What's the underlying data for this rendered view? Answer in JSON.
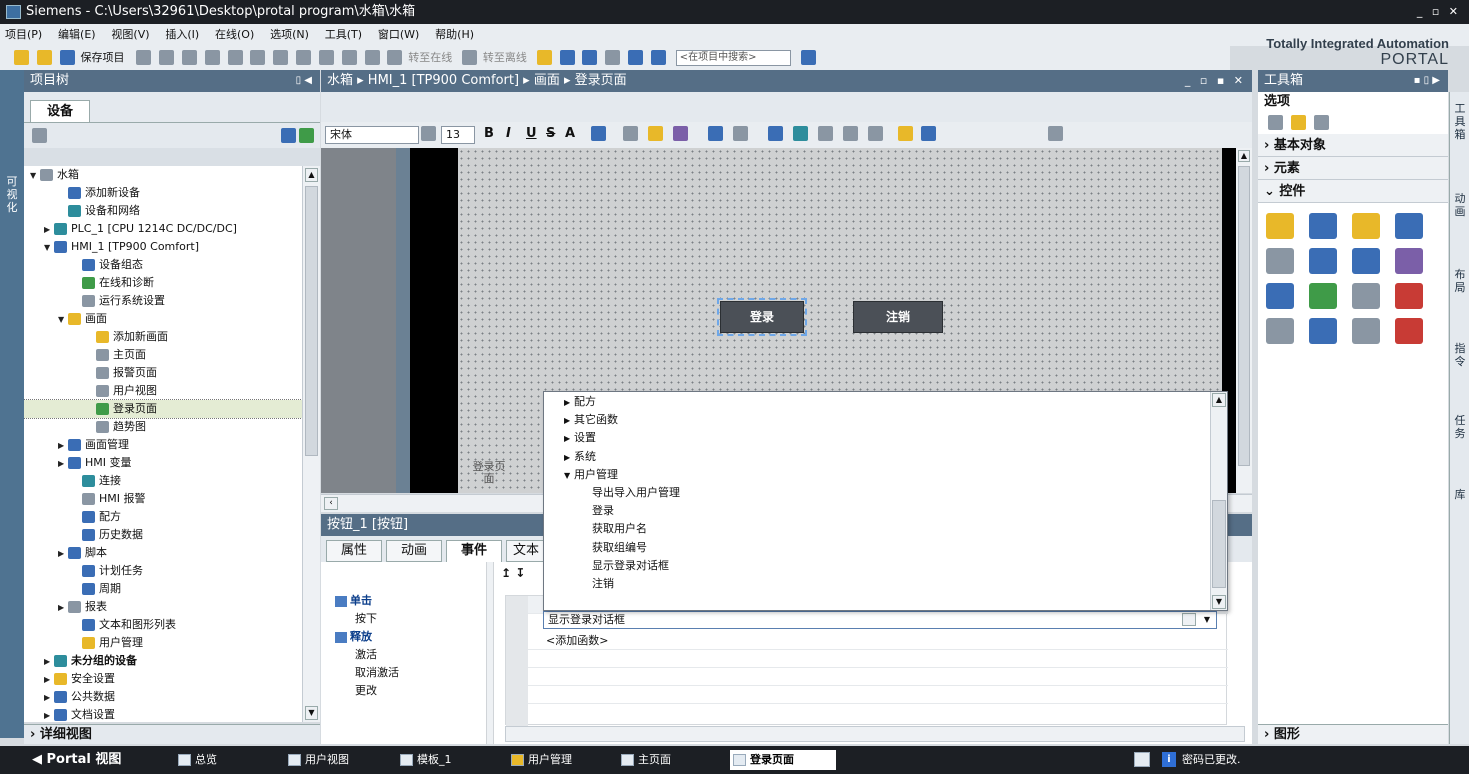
{
  "window": {
    "title": "Siemens  -  C:\\Users\\32961\\Desktop\\protal program\\水箱\\水箱",
    "controls": "_ ▫ ✕"
  },
  "menubar": [
    "项目(P)",
    "编辑(E)",
    "视图(V)",
    "插入(I)",
    "在线(O)",
    "选项(N)",
    "工具(T)",
    "窗口(W)",
    "帮助(H)"
  ],
  "toolbar": {
    "save_label": "保存项目",
    "go_online": "转至在线",
    "go_offline": "转至离线",
    "search_placeholder": "<在项目中搜索>"
  },
  "brand": {
    "line1": "Totally Integrated Automation",
    "line2": "PORTAL"
  },
  "left_vtab": "可视化",
  "project_tree": {
    "title": "项目树",
    "tab": "设备",
    "items": [
      {
        "label": "水箱",
        "indent": 0,
        "arrow": "▼",
        "icon": "ico-grey"
      },
      {
        "label": "添加新设备",
        "indent": 2,
        "arrow": "",
        "icon": "ico-blue"
      },
      {
        "label": "设备和网络",
        "indent": 2,
        "arrow": "",
        "icon": "ico-teal"
      },
      {
        "label": "PLC_1 [CPU 1214C DC/DC/DC]",
        "indent": 1,
        "arrow": "▶",
        "icon": "ico-teal"
      },
      {
        "label": "HMI_1 [TP900 Comfort]",
        "indent": 1,
        "arrow": "▼",
        "icon": "ico-blue"
      },
      {
        "label": "设备组态",
        "indent": 3,
        "arrow": "",
        "icon": "ico-blue"
      },
      {
        "label": "在线和诊断",
        "indent": 3,
        "arrow": "",
        "icon": "ico-green"
      },
      {
        "label": "运行系统设置",
        "indent": 3,
        "arrow": "",
        "icon": "ico-grey"
      },
      {
        "label": "画面",
        "indent": 2,
        "arrow": "▼",
        "icon": "ico-yellow"
      },
      {
        "label": "添加新画面",
        "indent": 4,
        "arrow": "",
        "icon": "ico-yellow"
      },
      {
        "label": "主页面",
        "indent": 4,
        "arrow": "",
        "icon": "ico-grey"
      },
      {
        "label": "报警页面",
        "indent": 4,
        "arrow": "",
        "icon": "ico-grey"
      },
      {
        "label": "用户视图",
        "indent": 4,
        "arrow": "",
        "icon": "ico-grey"
      },
      {
        "label": "登录页面",
        "indent": 4,
        "arrow": "",
        "icon": "ico-green",
        "selected": true
      },
      {
        "label": "趋势图",
        "indent": 4,
        "arrow": "",
        "icon": "ico-grey"
      },
      {
        "label": "画面管理",
        "indent": 2,
        "arrow": "▶",
        "icon": "ico-blue"
      },
      {
        "label": "HMI 变量",
        "indent": 2,
        "arrow": "▶",
        "icon": "ico-blue"
      },
      {
        "label": "连接",
        "indent": 3,
        "arrow": "",
        "icon": "ico-teal"
      },
      {
        "label": "HMI 报警",
        "indent": 3,
        "arrow": "",
        "icon": "ico-grey"
      },
      {
        "label": "配方",
        "indent": 3,
        "arrow": "",
        "icon": "ico-blue"
      },
      {
        "label": "历史数据",
        "indent": 3,
        "arrow": "",
        "icon": "ico-blue"
      },
      {
        "label": "脚本",
        "indent": 2,
        "arrow": "▶",
        "icon": "ico-blue"
      },
      {
        "label": "计划任务",
        "indent": 3,
        "arrow": "",
        "icon": "ico-blue"
      },
      {
        "label": "周期",
        "indent": 3,
        "arrow": "",
        "icon": "ico-blue"
      },
      {
        "label": "报表",
        "indent": 2,
        "arrow": "▶",
        "icon": "ico-grey"
      },
      {
        "label": "文本和图形列表",
        "indent": 3,
        "arrow": "",
        "icon": "ico-blue"
      },
      {
        "label": "用户管理",
        "indent": 3,
        "arrow": "",
        "icon": "ico-yellow"
      },
      {
        "label": "未分组的设备",
        "indent": 1,
        "arrow": "▶",
        "icon": "ico-teal",
        "bold": true
      },
      {
        "label": "安全设置",
        "indent": 1,
        "arrow": "▶",
        "icon": "ico-yellow"
      },
      {
        "label": "公共数据",
        "indent": 1,
        "arrow": "▶",
        "icon": "ico-blue"
      },
      {
        "label": "文档设置",
        "indent": 1,
        "arrow": "▶",
        "icon": "ico-blue"
      }
    ],
    "detail_view": "详细视图"
  },
  "editor": {
    "breadcrumb": "水箱  ▸  HMI_1 [TP900 Comfort]  ▸  画面  ▸  登录页面",
    "font_name": "宋体",
    "font_size": "13",
    "format_buttons": [
      "B",
      "I",
      "U",
      "S",
      "A"
    ],
    "login_button": "登录",
    "logout_button": "注销",
    "screen_label": "登录页面"
  },
  "properties": {
    "title": "按钮_1 [按钮]",
    "tabs": [
      "属性",
      "动画",
      "事件",
      "文本"
    ],
    "active_tab": "事件",
    "events": [
      {
        "label": "单击",
        "header": true
      },
      {
        "label": "按下",
        "header": false
      },
      {
        "label": "释放",
        "header": true
      },
      {
        "label": "激活",
        "header": false
      },
      {
        "label": "取消激活",
        "header": false
      },
      {
        "label": "更改",
        "header": false
      }
    ],
    "function_value": "显示登录对话框",
    "add_function": "<添加函数>"
  },
  "function_dropdown": {
    "items": [
      {
        "label": "配方",
        "arrow": "▶",
        "indent": 0
      },
      {
        "label": "其它函数",
        "arrow": "▶",
        "indent": 0
      },
      {
        "label": "设置",
        "arrow": "▶",
        "indent": 0
      },
      {
        "label": "系统",
        "arrow": "▶",
        "indent": 0
      },
      {
        "label": "用户管理",
        "arrow": "▼",
        "indent": 0
      },
      {
        "label": "导出导入用户管理",
        "arrow": "",
        "indent": 1
      },
      {
        "label": "登录",
        "arrow": "",
        "indent": 1
      },
      {
        "label": "获取用户名",
        "arrow": "",
        "indent": 1
      },
      {
        "label": "获取组编号",
        "arrow": "",
        "indent": 1
      },
      {
        "label": "显示登录对话框",
        "arrow": "",
        "indent": 1
      },
      {
        "label": "注销",
        "arrow": "",
        "indent": 1
      }
    ]
  },
  "toolbox": {
    "title": "工具箱",
    "options": "选项",
    "sections": [
      "基本对象",
      "元素",
      "控件"
    ],
    "bottom_section": "图形"
  },
  "right_vtabs": [
    "工具箱",
    "动画",
    "布局",
    "指令",
    "任务",
    "库"
  ],
  "statusbar": {
    "portal_view": "◀  Portal 视图",
    "items": [
      "总览",
      "用户视图",
      "模板_1",
      "用户管理",
      "主页面",
      "登录页面"
    ],
    "active_item": "登录页面",
    "message": "密码已更改."
  }
}
